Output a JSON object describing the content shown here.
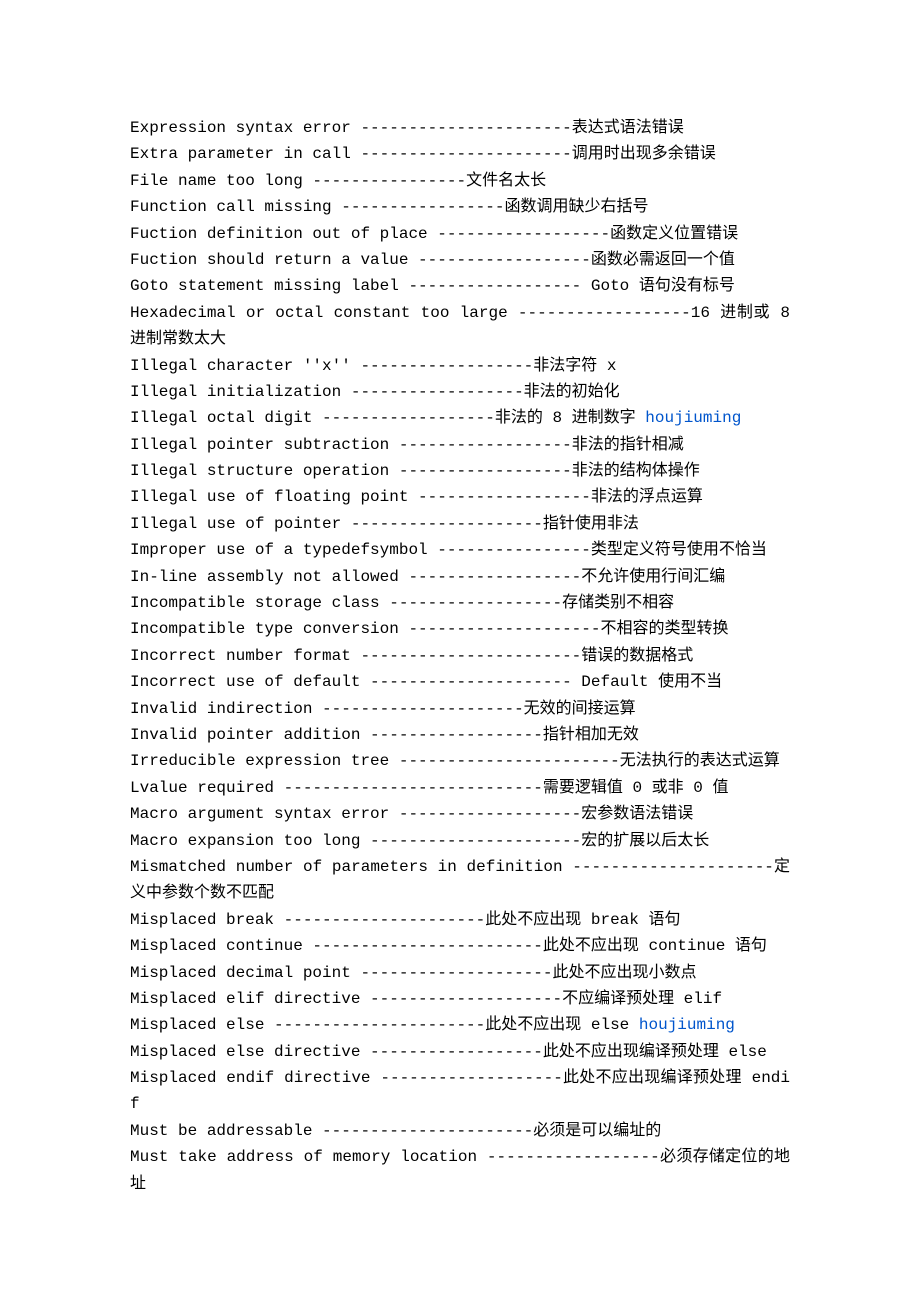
{
  "lines": [
    {
      "en": "Expression syntax error",
      "sep": " ----------------------",
      "cn": "表达式语法错误",
      "blue": null
    },
    {
      "en": "Extra parameter in call",
      "sep": " ----------------------",
      "cn": "调用时出现多余错误",
      "blue": null
    },
    {
      "en": "File name too long",
      "sep": " ----------------",
      "cn": "文件名太长",
      "blue": null
    },
    {
      "en": "Function call missing",
      "sep": " -----------------",
      "cn": "函数调用缺少右括号",
      "blue": null
    },
    {
      "en": "Fuction definition out of place",
      "sep": " ------------------",
      "cn": "函数定义位置错误",
      "blue": null
    },
    {
      "en": "Fuction should return a value",
      "sep": " ------------------",
      "cn": "函数必需返回一个值",
      "blue": null
    },
    {
      "en": "Goto statement missing label",
      "sep": " ------------------ ",
      "cn": "Goto 语句没有标号",
      "blue": null
    },
    {
      "en": "Hexadecimal or octal constant too large",
      "sep": " ------------------",
      "cn": "16 进制或 8 进制常数太大",
      "blue": null
    },
    {
      "en": "Illegal character ''x''",
      "sep": " ------------------",
      "cn": "非法字符 x",
      "blue": null
    },
    {
      "en": "Illegal initialization",
      "sep": " ------------------",
      "cn": "非法的初始化",
      "blue": null
    },
    {
      "en": "Illegal octal digit",
      "sep": " ------------------",
      "cn": "非法的 8 进制数字 ",
      "blue": "houjiuming"
    },
    {
      "en": "Illegal pointer subtraction",
      "sep": " ------------------",
      "cn": "非法的指针相减",
      "blue": null
    },
    {
      "en": "Illegal structure operation",
      "sep": " ------------------",
      "cn": "非法的结构体操作",
      "blue": null
    },
    {
      "en": "Illegal use of floating point",
      "sep": " ------------------",
      "cn": "非法的浮点运算",
      "blue": null
    },
    {
      "en": "Illegal use of pointer",
      "sep": " --------------------",
      "cn": "指针使用非法",
      "blue": null
    },
    {
      "en": "Improper use of a typedefsymbol",
      "sep": " ----------------",
      "cn": "类型定义符号使用不恰当",
      "blue": null
    },
    {
      "en": "In-line assembly not allowed",
      "sep": " ------------------",
      "cn": "不允许使用行间汇编",
      "blue": null
    },
    {
      "en": "Incompatible storage class",
      "sep": " ------------------",
      "cn": "存储类别不相容",
      "blue": null
    },
    {
      "en": "Incompatible type conversion",
      "sep": " --------------------",
      "cn": "不相容的类型转换",
      "blue": null
    },
    {
      "en": "Incorrect number format",
      "sep": " -----------------------",
      "cn": "错误的数据格式",
      "blue": null
    },
    {
      "en": "Incorrect use of default",
      "sep": " --------------------- ",
      "cn": "Default 使用不当",
      "blue": null
    },
    {
      "en": "Invalid indirection",
      "sep": " ---------------------",
      "cn": "无效的间接运算",
      "blue": null
    },
    {
      "en": "Invalid pointer addition",
      "sep": " ------------------",
      "cn": "指针相加无效",
      "blue": null
    },
    {
      "en": "Irreducible expression tree",
      "sep": " -----------------------",
      "cn": "无法执行的表达式运算",
      "blue": null
    },
    {
      "en": "Lvalue required",
      "sep": " ---------------------------",
      "cn": "需要逻辑值 0 或非 0 值",
      "blue": null
    },
    {
      "en": "Macro argument syntax error",
      "sep": " -------------------",
      "cn": "宏参数语法错误",
      "blue": null
    },
    {
      "en": "Macro expansion too long",
      "sep": " ----------------------",
      "cn": "宏的扩展以后太长",
      "blue": null
    },
    {
      "en": "Mismatched number of parameters in definition",
      "sep": " ---------------------",
      "cn": "定义中参数个数不匹配",
      "blue": null
    },
    {
      "en": "Misplaced break",
      "sep": " ---------------------",
      "cn": "此处不应出现 break 语句",
      "blue": null
    },
    {
      "en": "Misplaced continue",
      "sep": " ------------------------",
      "cn": "此处不应出现 continue 语句",
      "blue": null
    },
    {
      "en": "Misplaced decimal point",
      "sep": " --------------------",
      "cn": "此处不应出现小数点",
      "blue": null
    },
    {
      "en": "Misplaced elif directive",
      "sep": " --------------------",
      "cn": "不应编译预处理 elif",
      "blue": null
    },
    {
      "en": "Misplaced else",
      "sep": " ----------------------",
      "cn": "此处不应出现 else ",
      "blue": "houjiuming"
    },
    {
      "en": "Misplaced else directive",
      "sep": "  ------------------",
      "cn": "此处不应出现编译预处理 else",
      "blue": null
    },
    {
      "en": "Misplaced endif directive",
      "sep": " -------------------",
      "cn": "此处不应出现编译预处理 endif",
      "blue": null
    },
    {
      "en": "Must be addressable",
      "sep": " ----------------------",
      "cn": "必须是可以编址的",
      "blue": null
    },
    {
      "en": "Must take address of memory location",
      "sep": " ------------------",
      "cn": "必须存储定位的地址",
      "blue": null
    }
  ]
}
